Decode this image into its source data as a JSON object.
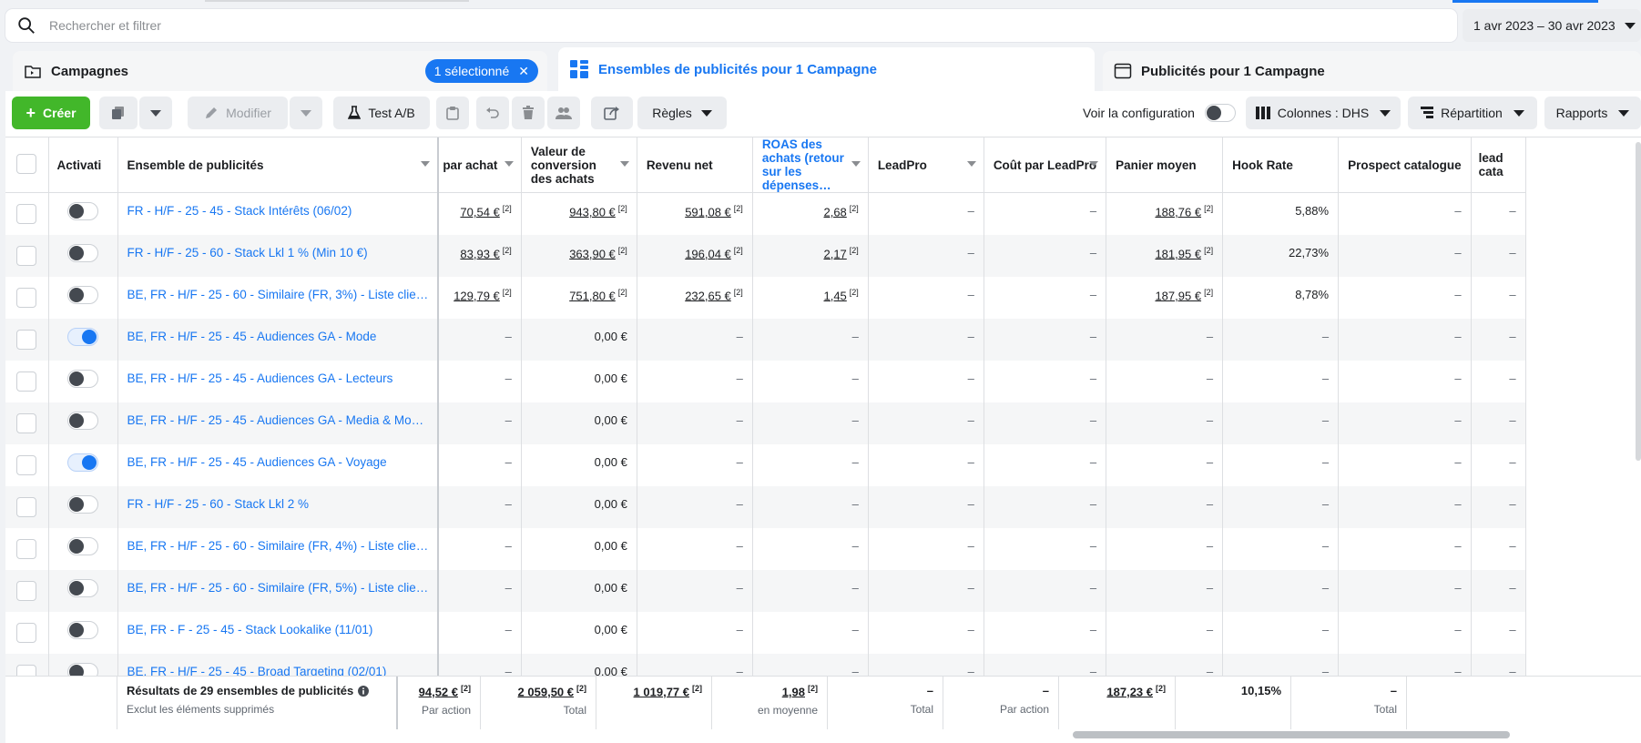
{
  "search": {
    "placeholder": "Rechercher et filtrer"
  },
  "date_range": "1 avr 2023 – 30 avr 2023",
  "tabs": {
    "campaigns": {
      "label": "Campagnes",
      "selected_pill": "1 sélectionné"
    },
    "adsets": {
      "label": "Ensembles de publicités pour 1 Campagne"
    },
    "ads": {
      "label": "Publicités pour 1 Campagne"
    }
  },
  "toolbar": {
    "create": "Créer",
    "edit": "Modifier",
    "ab_test": "Test A/B",
    "rules": "Règles",
    "view_config": "Voir la configuration",
    "columns": "Colonnes : DHS",
    "breakdown": "Répartition",
    "reports": "Rapports"
  },
  "columns": {
    "activation": "Activati",
    "adset": "Ensemble de publicités",
    "cost_per_purchase": "par achat",
    "conv_value": "Valeur de conversion des achats",
    "net_revenue": "Revenu net",
    "roas": "ROAS des achats (retour sur les dépenses…",
    "leadpro": "LeadPro",
    "cost_leadpro": "Coût par LeadPro",
    "avg_basket": "Panier moyen",
    "hook_rate": "Hook Rate",
    "prospect_catalogue": "Prospect catalogue",
    "extra": "lead cata"
  },
  "rows": [
    {
      "on": false,
      "name": "FR - H/F - 25 - 45 - Stack Intérêts (06/02)",
      "cpp": "70,54 €",
      "cv": "943,80 €",
      "rev": "591,08 €",
      "roas": "2,68",
      "lp": "–",
      "clp": "–",
      "basket": "188,76 €",
      "hook": "5,88%",
      "prosp": "–"
    },
    {
      "on": false,
      "name": "FR - H/F - 25 - 60 - Stack Lkl 1 % (Min 10 €)",
      "cpp": "83,93 €",
      "cv": "363,90 €",
      "rev": "196,04 €",
      "roas": "2,17",
      "lp": "–",
      "clp": "–",
      "basket": "181,95 €",
      "hook": "22,73%",
      "prosp": "–"
    },
    {
      "on": false,
      "name": "BE, FR - H/F - 25 - 60 - Similaire (FR, 3%) - Liste clie…",
      "cpp": "129,79 €",
      "cv": "751,80 €",
      "rev": "232,65 €",
      "roas": "1,45",
      "lp": "–",
      "clp": "–",
      "basket": "187,95 €",
      "hook": "8,78%",
      "prosp": "–"
    },
    {
      "on": true,
      "name": "BE, FR - H/F - 25 - 45 - Audiences GA - Mode",
      "cpp": "–",
      "cv": "0,00 €",
      "rev": "–",
      "roas": "–",
      "lp": "–",
      "clp": "–",
      "basket": "–",
      "hook": "–",
      "prosp": "–"
    },
    {
      "on": false,
      "name": "BE, FR - H/F - 25 - 45 - Audiences GA - Lecteurs",
      "cpp": "–",
      "cv": "0,00 €",
      "rev": "–",
      "roas": "–",
      "lp": "–",
      "clp": "–",
      "basket": "–",
      "hook": "–",
      "prosp": "–"
    },
    {
      "on": false,
      "name": "BE, FR - H/F - 25 - 45 - Audiences GA - Media & Mo…",
      "cpp": "–",
      "cv": "0,00 €",
      "rev": "–",
      "roas": "–",
      "lp": "–",
      "clp": "–",
      "basket": "–",
      "hook": "–",
      "prosp": "–"
    },
    {
      "on": true,
      "name": "BE, FR - H/F - 25 - 45 - Audiences GA - Voyage",
      "cpp": "–",
      "cv": "0,00 €",
      "rev": "–",
      "roas": "–",
      "lp": "–",
      "clp": "–",
      "basket": "–",
      "hook": "–",
      "prosp": "–"
    },
    {
      "on": false,
      "name": "FR - H/F - 25 - 60 - Stack Lkl 2 %",
      "cpp": "–",
      "cv": "0,00 €",
      "rev": "–",
      "roas": "–",
      "lp": "–",
      "clp": "–",
      "basket": "–",
      "hook": "–",
      "prosp": "–"
    },
    {
      "on": false,
      "name": "BE, FR - H/F - 25 - 60 - Similaire (FR, 4%) - Liste clie…",
      "cpp": "–",
      "cv": "0,00 €",
      "rev": "–",
      "roas": "–",
      "lp": "–",
      "clp": "–",
      "basket": "–",
      "hook": "–",
      "prosp": "–"
    },
    {
      "on": false,
      "name": "BE, FR - H/F - 25 - 60 - Similaire (FR, 5%) - Liste clie…",
      "cpp": "–",
      "cv": "0,00 €",
      "rev": "–",
      "roas": "–",
      "lp": "–",
      "clp": "–",
      "basket": "–",
      "hook": "–",
      "prosp": "–"
    },
    {
      "on": false,
      "name": "BE, FR - F - 25 - 45 - Stack Lookalike (11/01)",
      "cpp": "–",
      "cv": "0,00 €",
      "rev": "–",
      "roas": "–",
      "lp": "–",
      "clp": "–",
      "basket": "–",
      "hook": "–",
      "prosp": "–"
    },
    {
      "on": false,
      "name": "BE, FR - H/F - 25 - 45 - Broad Targeting (02/01)",
      "cpp": "–",
      "cv": "0,00 €",
      "rev": "–",
      "roas": "–",
      "lp": "–",
      "clp": "–",
      "basket": "–",
      "hook": "–",
      "prosp": "–"
    }
  ],
  "footer": {
    "title": "Résultats de 29 ensembles de publicités",
    "subtitle": "Exclut les éléments supprimés",
    "cpp": "94,52 €",
    "cpp_sub": "Par action",
    "cv": "2 059,50 €",
    "cv_sub": "Total",
    "rev": "1 019,77 €",
    "roas": "1,98",
    "roas_sub": "en moyenne",
    "lp": "–",
    "lp_sub": "Total",
    "clp": "–",
    "clp_sub": "Par action",
    "basket": "187,23 €",
    "hook": "10,15%",
    "prosp": "–",
    "prosp_sub": "Total",
    "sup": "[2]"
  },
  "colors": {
    "accent": "#1877f2",
    "create": "#42b72a"
  }
}
